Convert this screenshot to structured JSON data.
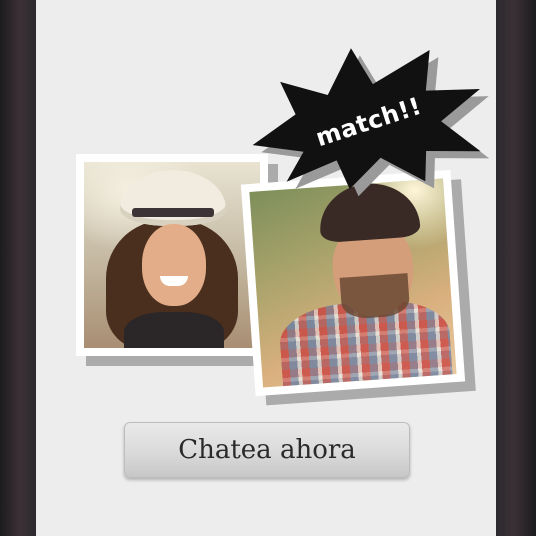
{
  "match_badge": {
    "text": "match!!"
  },
  "photos": [
    {
      "name": "woman-profile-photo"
    },
    {
      "name": "man-profile-photo"
    }
  ],
  "chat_button": {
    "label": "Chatea ahora"
  },
  "colors": {
    "screen_background": "#ededed",
    "burst": "#111111",
    "burst_shadow": "#9a9a9a",
    "photo_border": "#ffffff"
  }
}
